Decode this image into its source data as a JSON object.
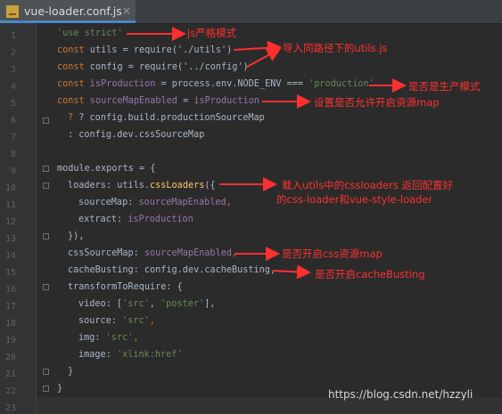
{
  "tab": {
    "title": "vue-loader.conf.js",
    "icon": "js-file-icon",
    "close": "×"
  },
  "line_numbers": [
    "1",
    "2",
    "3",
    "4",
    "5",
    "6",
    "7",
    "8",
    "9",
    "10",
    "11",
    "12",
    "13",
    "14",
    "15",
    "16",
    "17",
    "18",
    "19",
    "20",
    "21",
    "22",
    "23"
  ],
  "code": {
    "l1": "'use strict'",
    "l2a": "const",
    "l2b": " utils = ",
    "l2c": "require",
    "l2d": "('./utils')",
    "l3a": "const",
    "l3b": " config = ",
    "l3c": "require",
    "l3d": "('../config')",
    "l4a": "const",
    "l4b": " isProduction",
    "l4c": " = process.env.NODE_ENV === ",
    "l4d": "'production'",
    "l5a": "const",
    "l5b": " sourceMapEnabled",
    "l5c": " = ",
    "l5d": "isProduction",
    "l6": "? config.build.productionSourceMap",
    "l7": ": config.dev.cssSourceMap",
    "l9": "module.exports = {",
    "l10a": "loaders",
    "l10b": ": utils.",
    "l10c": "cssLoaders",
    "l10d": "({",
    "l11a": "sourceMap",
    "l11b": ": ",
    "l11c": "sourceMapEnabled",
    "l11d": ",",
    "l12a": "extract",
    "l12b": ": ",
    "l12c": "isProduction",
    "l13": "}),",
    "l14a": "cssSourceMap",
    "l14b": ": ",
    "l14c": "sourceMapEnabled",
    "l14d": ",",
    "l15a": "cacheBusting",
    "l15b": ": config.dev.cacheBusting,",
    "l16": "transformToRequire: {",
    "l17a": "video: [",
    "l17b": "'src'",
    "l17c": ", ",
    "l17d": "'poster'",
    "l17e": "],",
    "l18a": "source: ",
    "l18b": "'src'",
    "l18c": ",",
    "l19a": "img: ",
    "l19b": "'src'",
    "l19c": ",",
    "l20a": "image: ",
    "l20b": "'xlink:href'",
    "l21": "}",
    "l22": "}"
  },
  "annotations": {
    "a1": "js严格模式",
    "a2": "导入同路径下的utils.js",
    "a4": "是否是生产模式",
    "a5": "设置是否允许开启资源map",
    "a10": "载入utils中的cssloaders  返回配置好",
    "a10b": "的css-loader和vue-style-loader",
    "a14": "是否开启css资源map",
    "a15": "是否开启cacheBusting"
  },
  "watermark": "https://blog.csdn.net/hzzyli",
  "colors": {
    "keyword": "#cc7832",
    "string": "#6a8759",
    "property": "#9876aa",
    "function": "#ffc66d",
    "annotation": "#ff3030",
    "background": "#2b2b2b"
  }
}
